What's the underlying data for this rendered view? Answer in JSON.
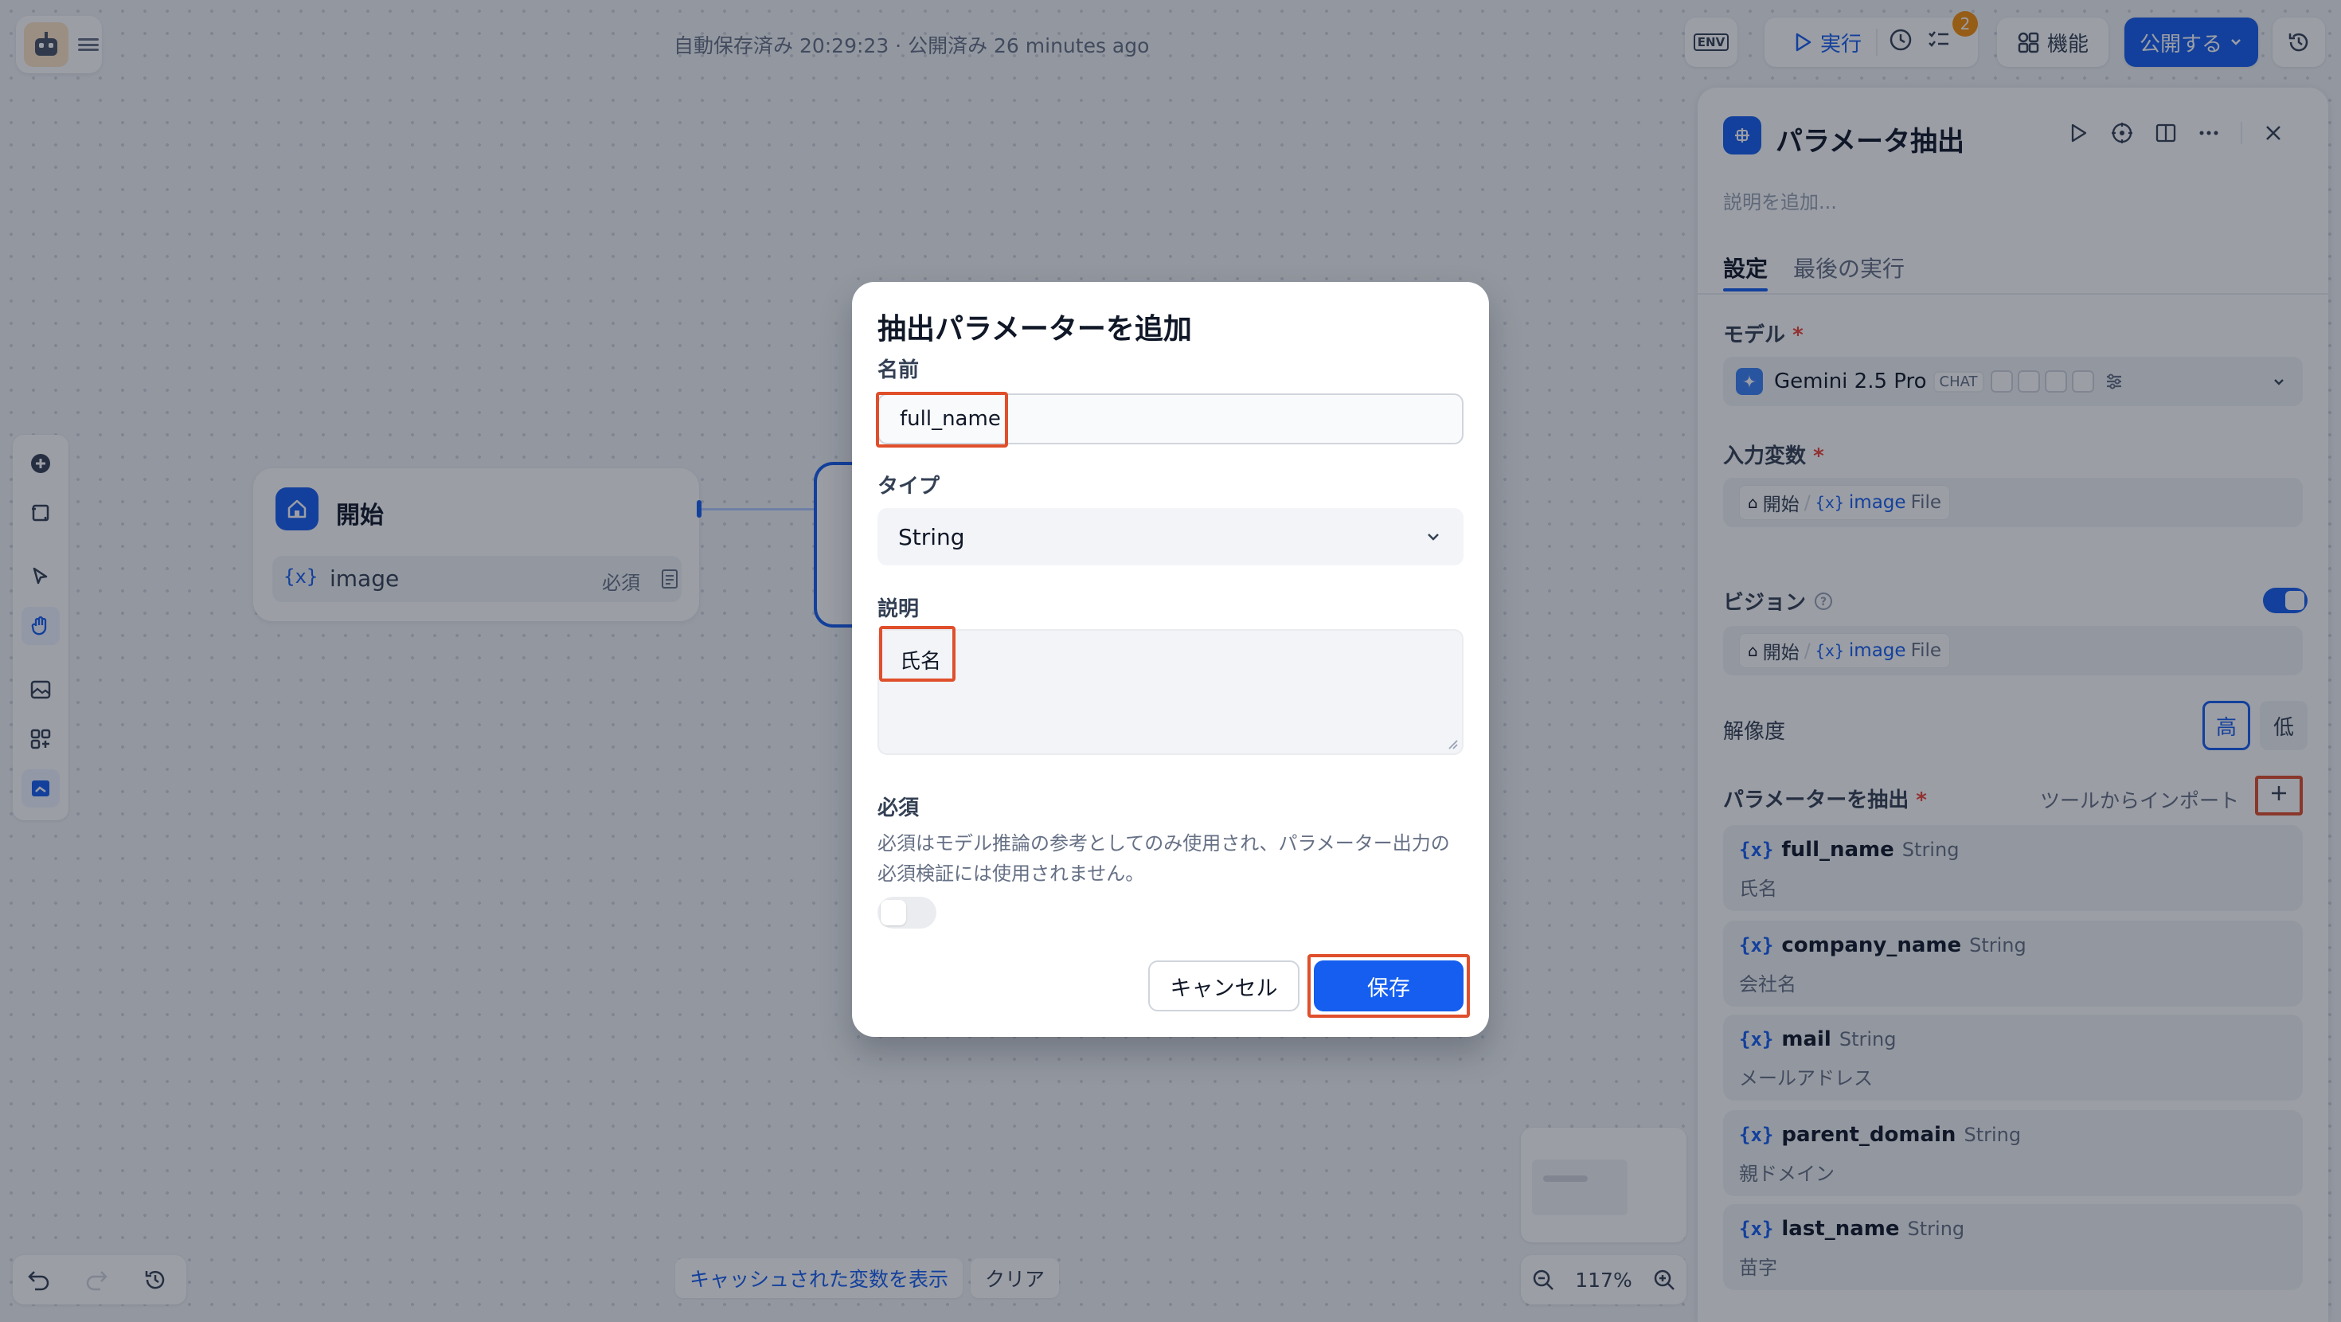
{
  "app": {
    "save_status": "自動保存済み 20:29:23 · 公開済み 26 minutes ago"
  },
  "toolbar": {
    "env_label": "ENV",
    "run_label": "実行",
    "badge_count": "2",
    "features_label": "機能",
    "publish_label": "公開する"
  },
  "canvas": {
    "start_node": {
      "title": "開始",
      "var_name": "image",
      "var_required": "必須"
    },
    "cache_show_label": "キャッシュされた変数を表示",
    "cache_clear_label": "クリア",
    "zoom_level": "117%"
  },
  "panel": {
    "title": "パラメータ抽出",
    "description_placeholder": "説明を追加...",
    "tabs": [
      {
        "label": "設定"
      },
      {
        "label": "最後の実行"
      }
    ],
    "model_label": "モデル",
    "model_name": "Gemini 2.5 Pro",
    "model_chip": "CHAT",
    "input_var_label": "入力変数",
    "start_crumb": "開始",
    "var_image": "image",
    "var_type_file": "File",
    "vision_label": "ビジョン",
    "resolution_label": "解像度",
    "resolution_high": "高",
    "resolution_low": "低",
    "extract_label": "パラメーターを抽出",
    "import_label": "ツールからインポート",
    "params": [
      {
        "name": "full_name",
        "type": "String",
        "desc": "氏名"
      },
      {
        "name": "company_name",
        "type": "String",
        "desc": "会社名"
      },
      {
        "name": "mail",
        "type": "String",
        "desc": "メールアドレス"
      },
      {
        "name": "parent_domain",
        "type": "String",
        "desc": "親ドメイン"
      },
      {
        "name": "last_name",
        "type": "String",
        "desc": "苗字"
      }
    ]
  },
  "modal": {
    "title": "抽出パラメーターを追加",
    "name_label": "名前",
    "name_value": "full_name",
    "type_label": "タイプ",
    "type_value": "String",
    "desc_label": "説明",
    "desc_value": "氏名",
    "required_label": "必須",
    "required_help": "必須はモデル推論の参考としてのみ使用され、パラメーター出力の必須検証には使用されません。",
    "cancel_label": "キャンセル",
    "save_label": "保存"
  },
  "colors": {
    "accent": "#155eef",
    "highlight": "#e04f2b",
    "badge": "#f79009"
  }
}
